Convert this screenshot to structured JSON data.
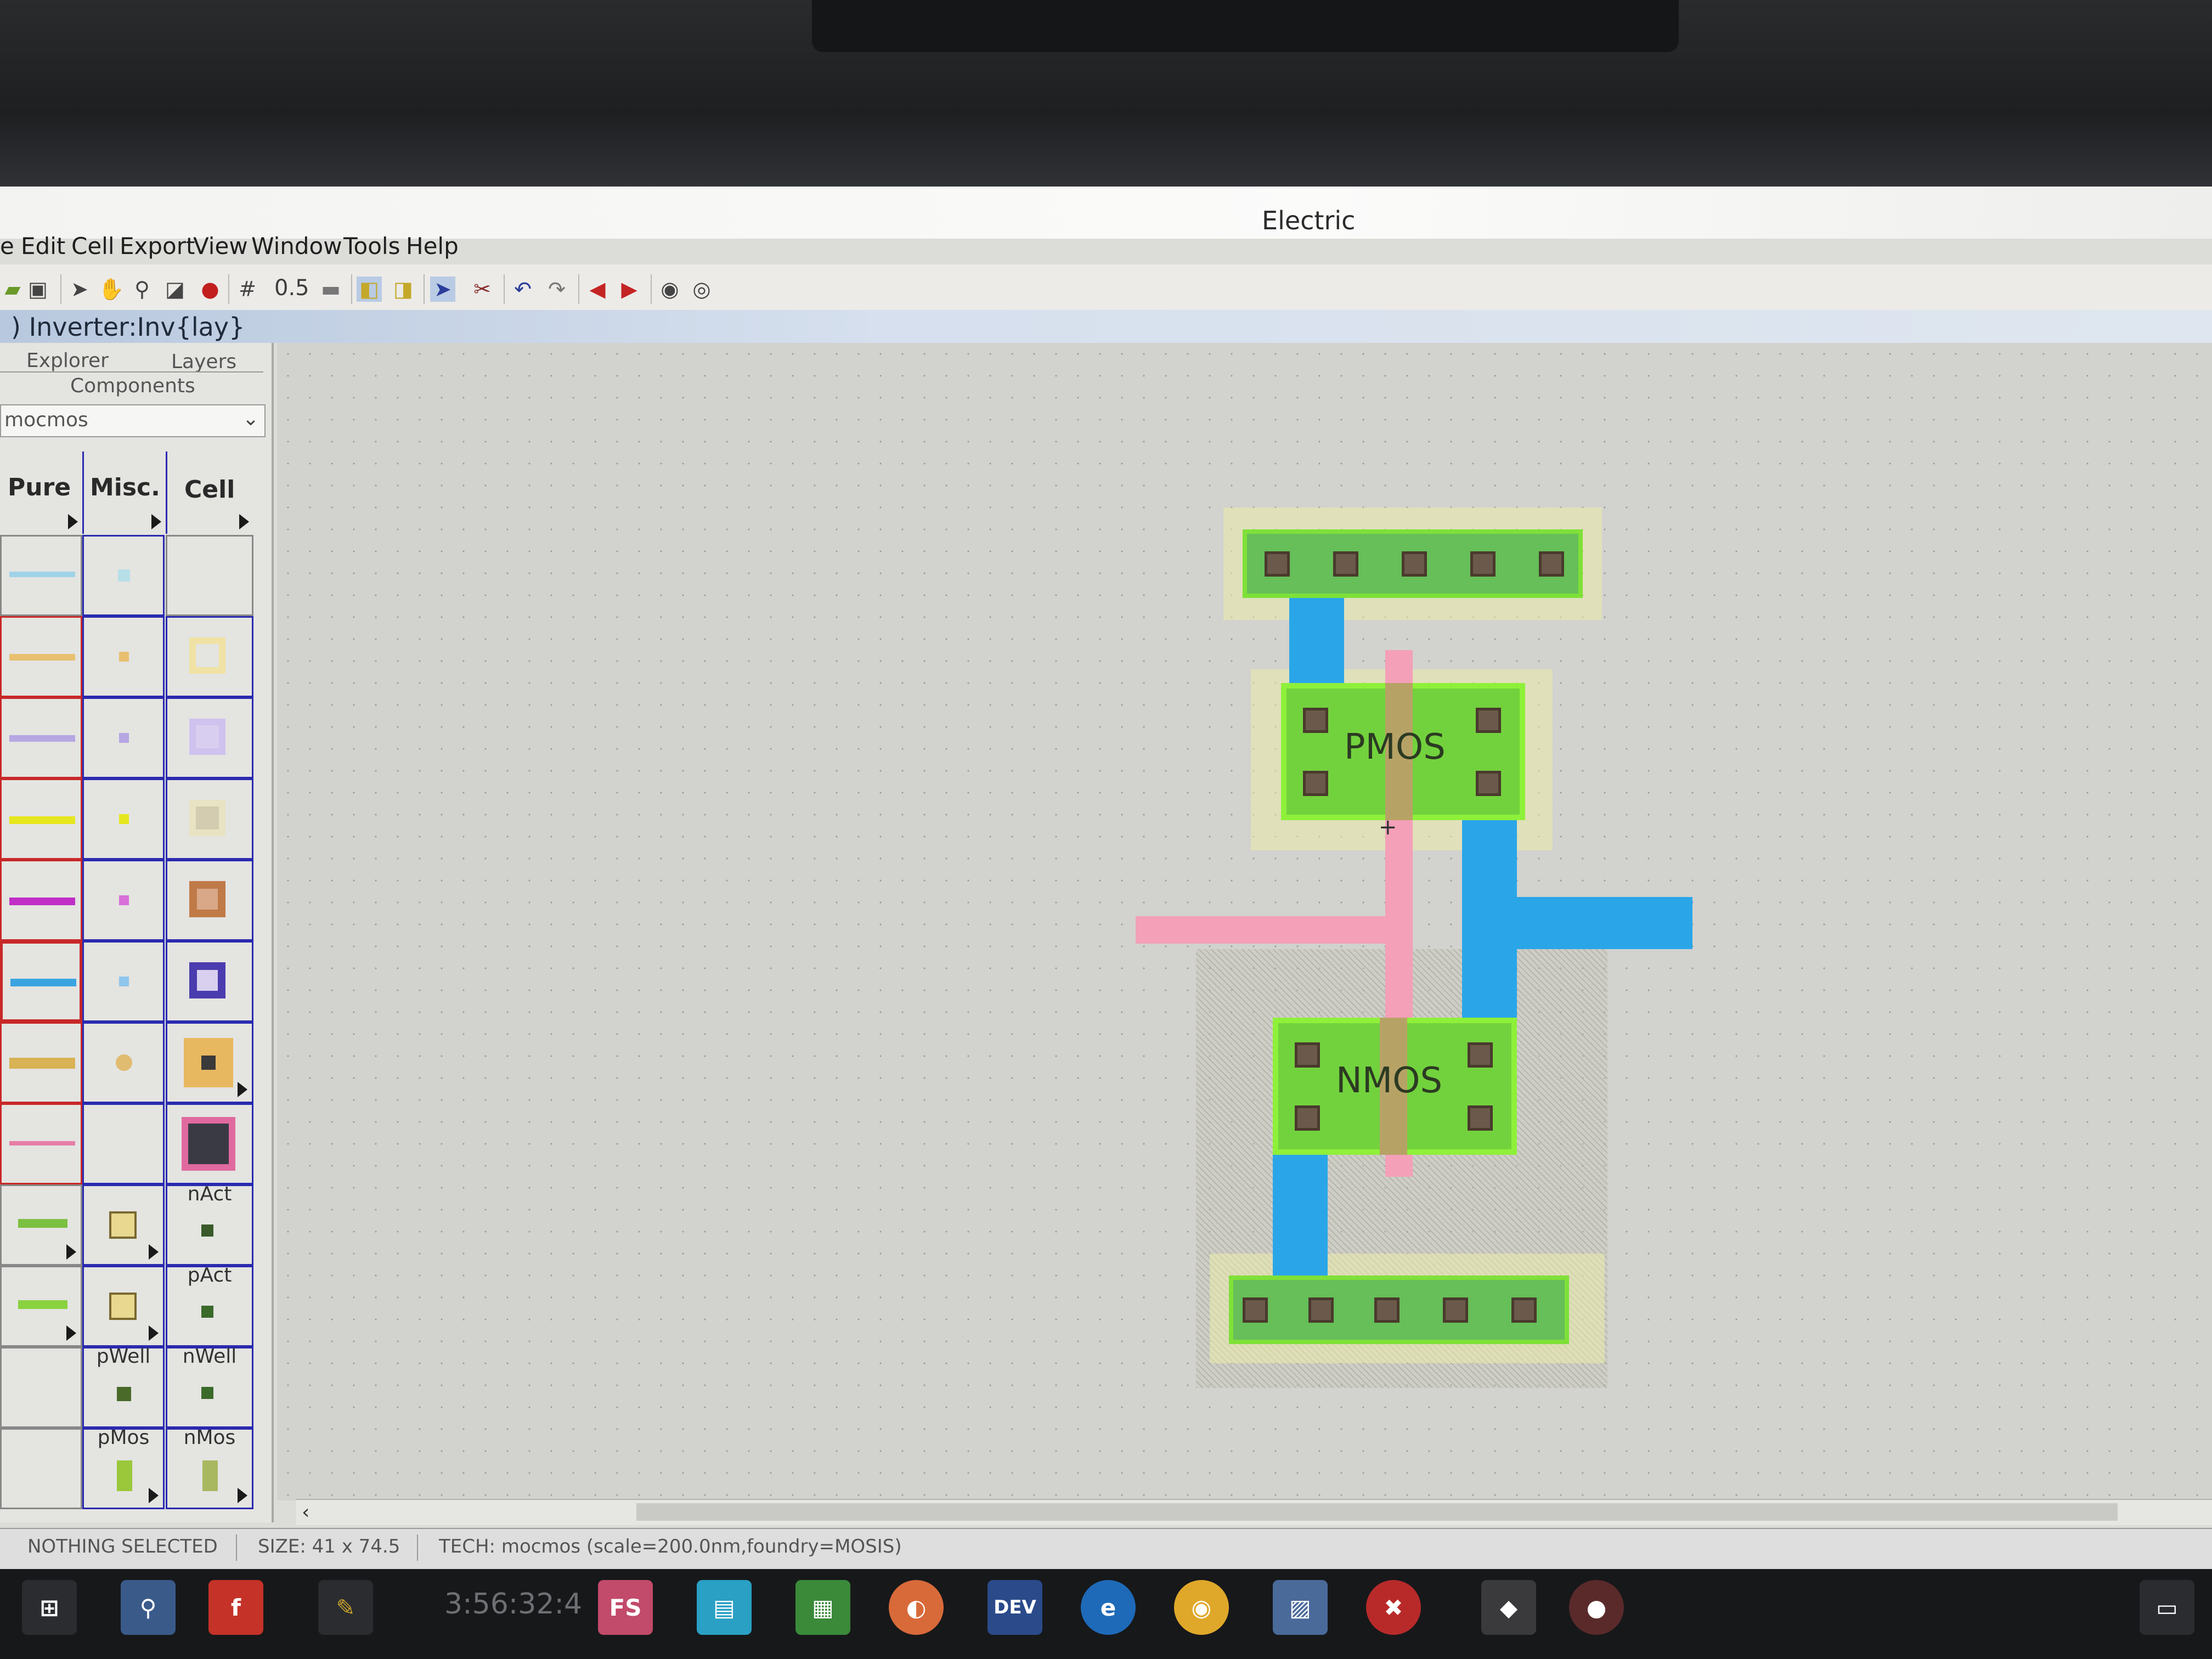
{
  "app": {
    "title": "Electric"
  },
  "menu": {
    "items": [
      "e",
      "Edit",
      "Cell",
      "Export",
      "View",
      "Window",
      "Tools",
      "Help"
    ]
  },
  "toolbar": {
    "grid_value": "0.5"
  },
  "cell_path": ") Inverter:Inv{lay}",
  "sidebar": {
    "tabs": [
      "Explorer",
      "Layers",
      "Components"
    ],
    "technology": "mocmos",
    "palette_headers": [
      "Pure",
      "Misc.",
      "Cell"
    ],
    "labels": [
      "nAct",
      "pAct",
      "pWell",
      "nWell",
      "pMos",
      "nMos"
    ]
  },
  "layout": {
    "pmos_label": "PMOS",
    "nmos_label": "NMOS"
  },
  "status": {
    "selection": "NOTHING SELECTED",
    "size": "SIZE: 41 x 74.5",
    "tech": "TECH: mocmos (scale=200.0nm,foundry=MOSIS)"
  },
  "taskbar": {
    "clock": "3:56:32:4",
    "apps": [
      "FS",
      "DEV"
    ]
  },
  "colors": {
    "metal1": "#2aa6e8",
    "poly": "#f3a0b8",
    "active": "#72d23d",
    "select": "#ebebaa"
  }
}
